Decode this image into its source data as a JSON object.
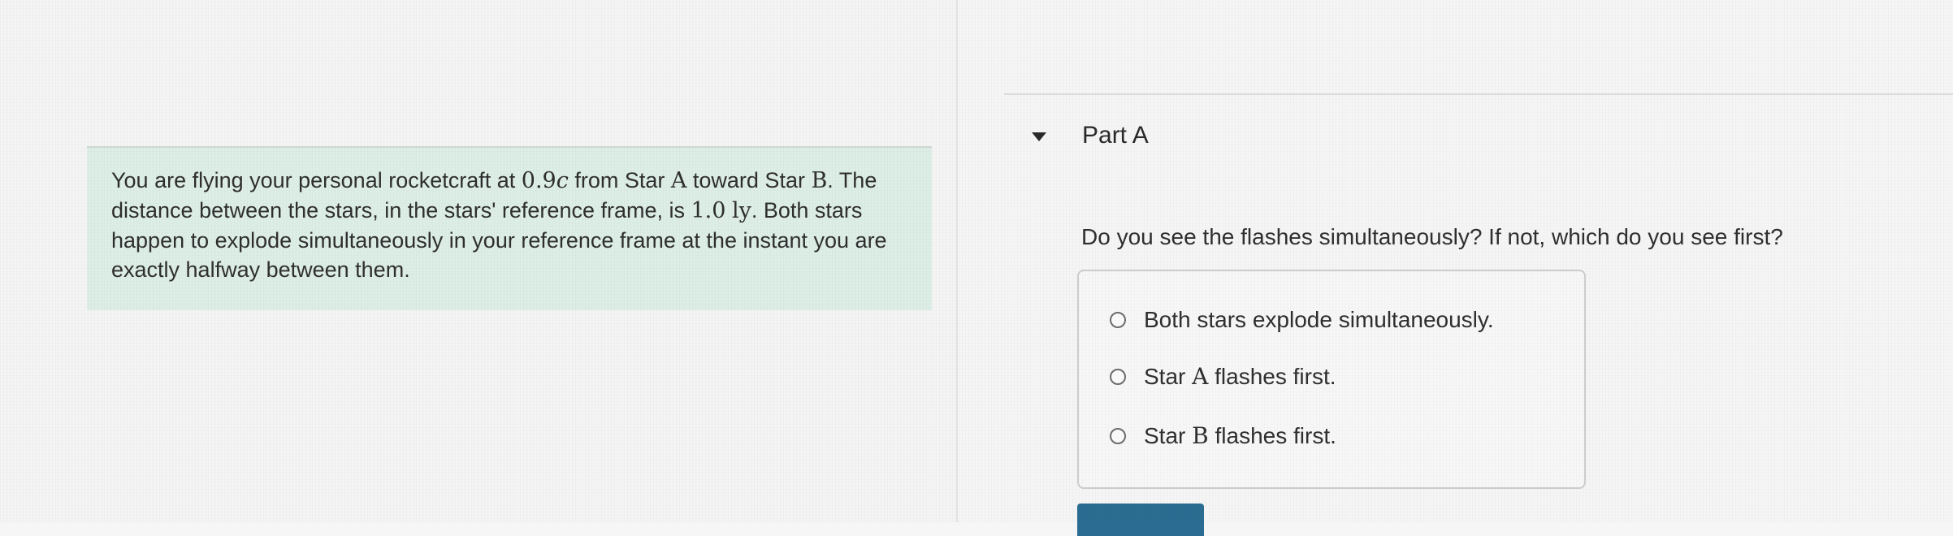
{
  "problem": {
    "text_1": "You are flying your personal rocketcraft at ",
    "speed_num": "0.9",
    "speed_c": "c",
    "text_2": " from Star ",
    "star_a": "A",
    "text_3": " toward Star ",
    "star_b": "B",
    "text_4": ". The distance between the stars, in the stars' reference frame, is ",
    "distance_num": "1.0",
    "distance_unit": "ly",
    "text_5": ". Both stars happen to explode simultaneously in your reference frame at the instant you are exactly halfway between them."
  },
  "part": {
    "title": "Part A",
    "question": "Do you see the flashes simultaneously? If not, which do you see first?"
  },
  "options": [
    {
      "pre": "Both stars explode simultaneously.",
      "math": "",
      "post": ""
    },
    {
      "pre": "Star ",
      "math": "A",
      "post": " flashes first."
    },
    {
      "pre": "Star ",
      "math": "B",
      "post": " flashes first."
    }
  ],
  "colors": {
    "problem_background": "#ddeee6",
    "submit_button": "#2b6d92"
  }
}
